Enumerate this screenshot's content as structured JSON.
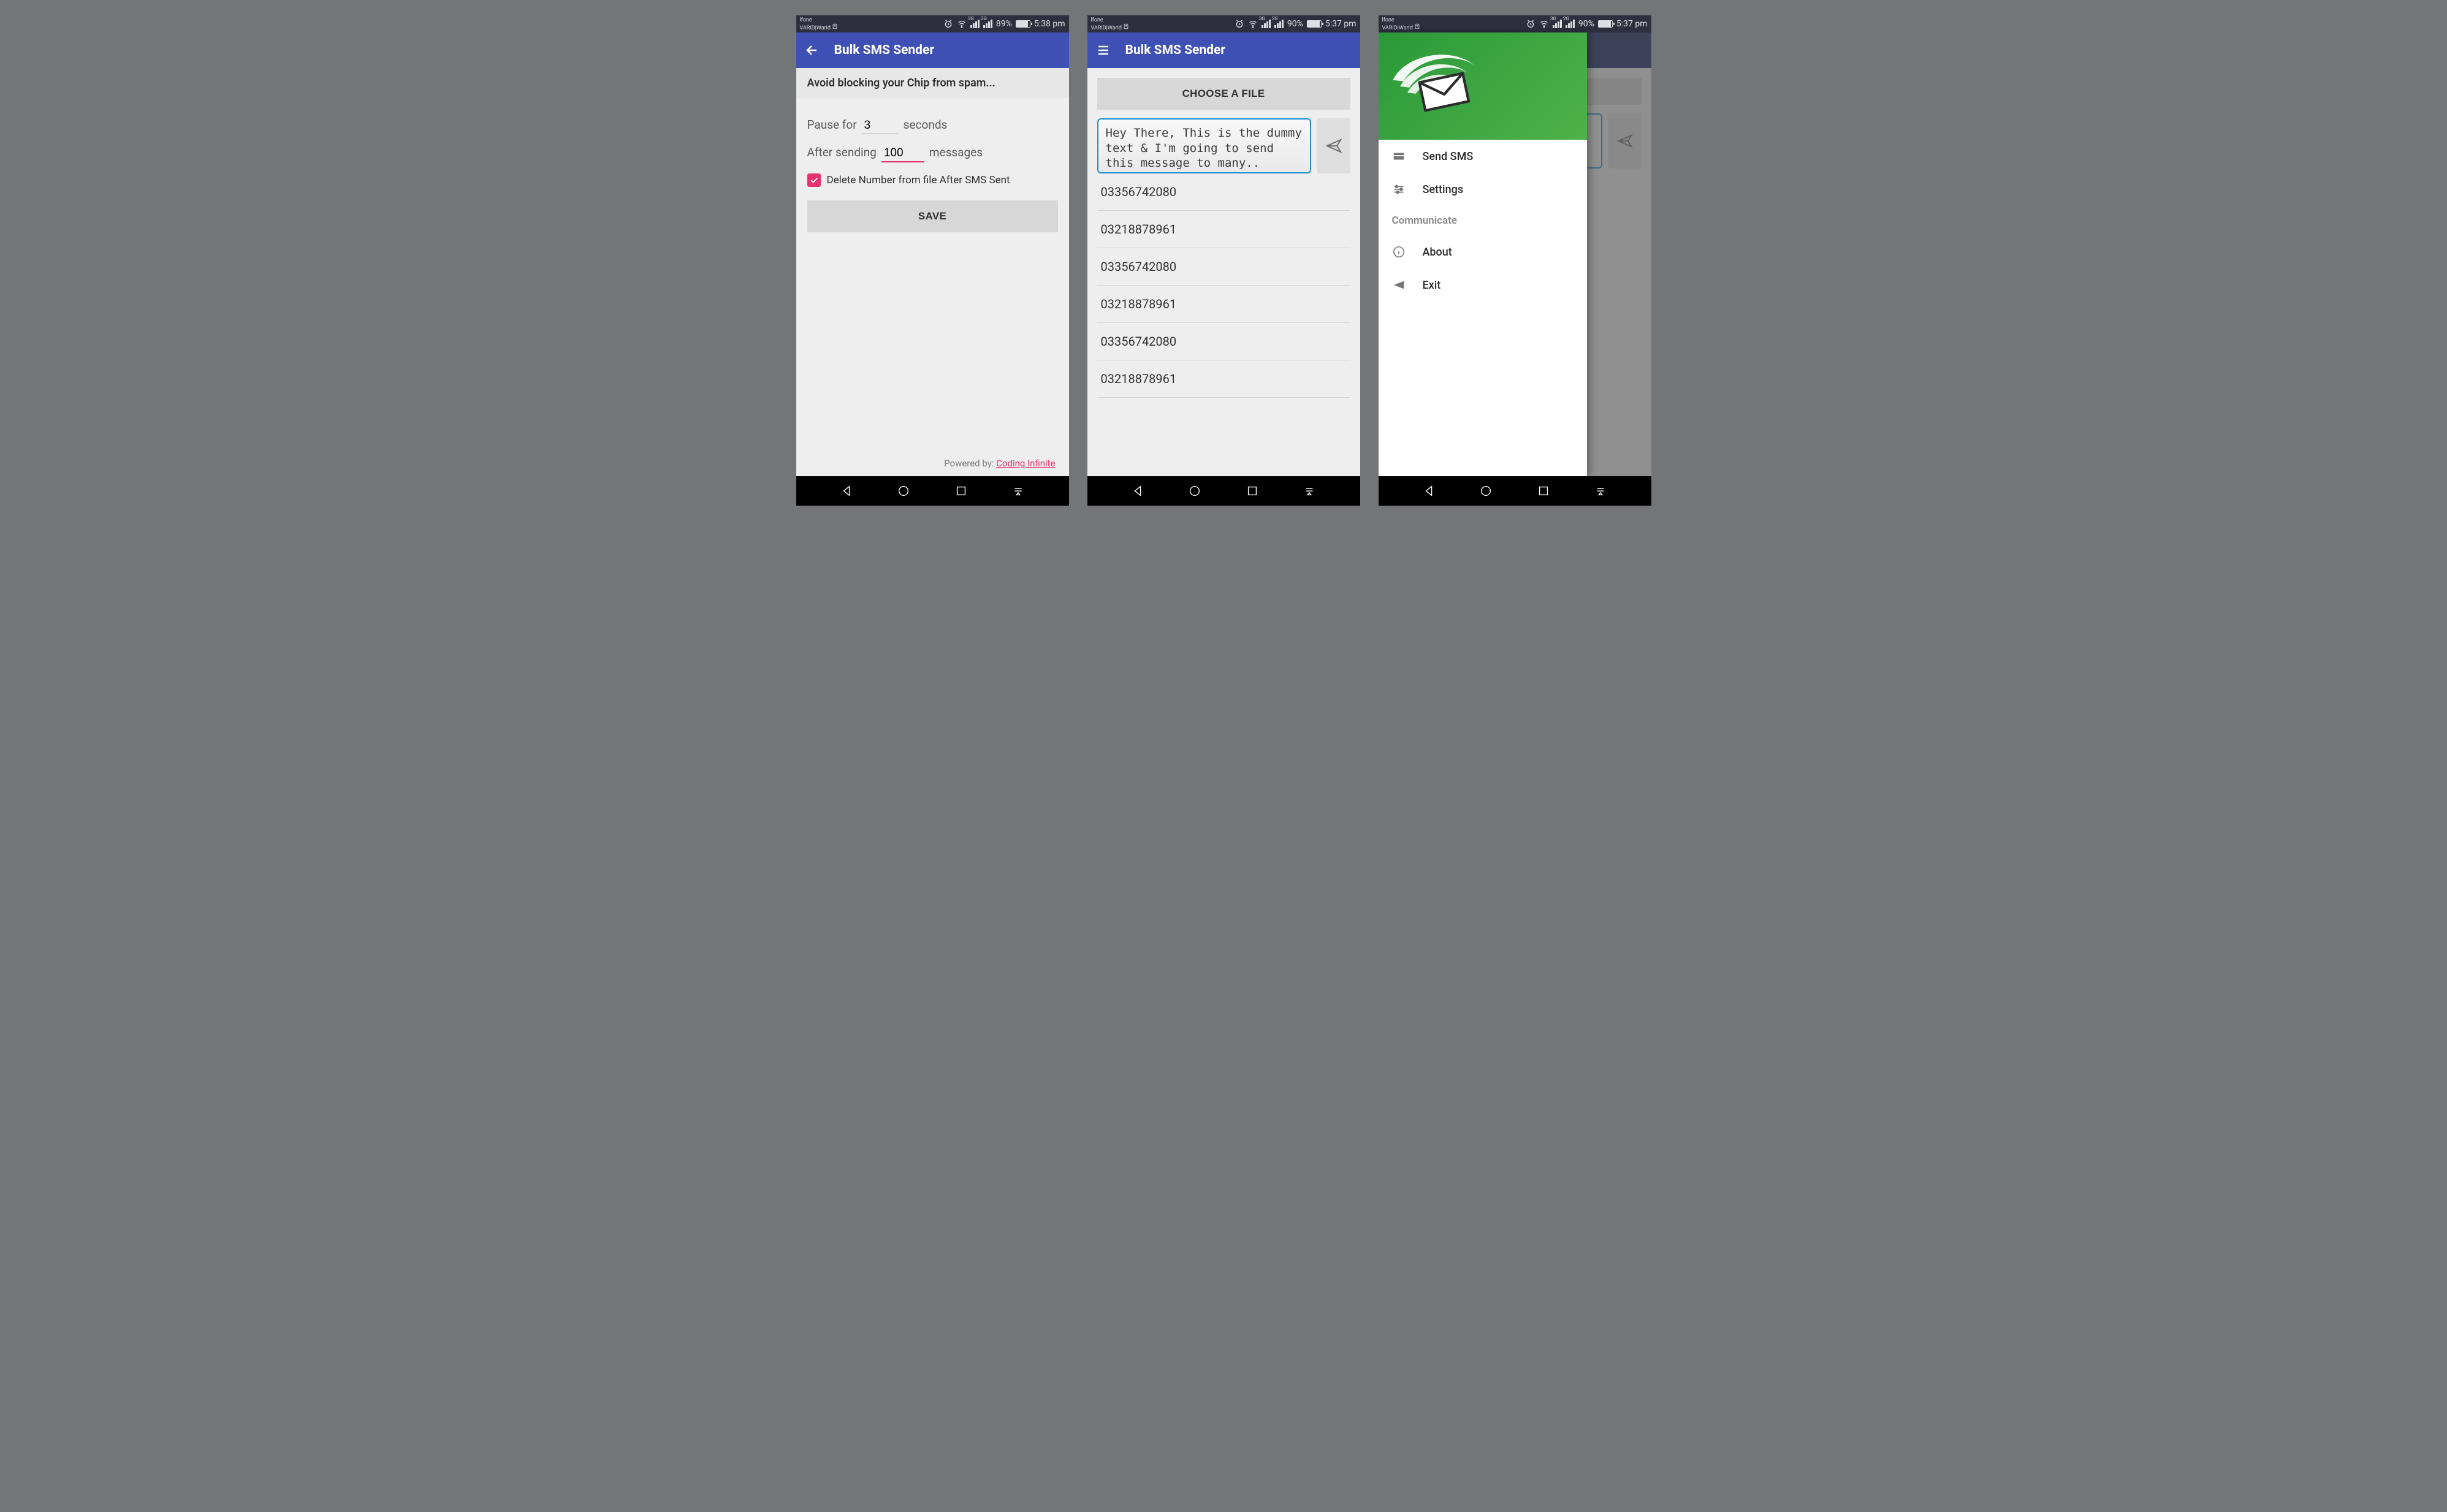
{
  "colors": {
    "appbar": "#3e50b4",
    "accent": "#e6336f",
    "drawer_green": "#3fa043"
  },
  "status_bars": [
    {
      "carrier_top": "lfone",
      "carrier_bottom": "VARID|Warid",
      "battery_pct": "89%",
      "time": "5:38 pm",
      "sig1": "3G",
      "sig2": "2G"
    },
    {
      "carrier_top": "lfone",
      "carrier_bottom": "VARID|Warid",
      "battery_pct": "90%",
      "time": "5:37 pm",
      "sig1": "3G",
      "sig2": "2G"
    },
    {
      "carrier_top": "lfone",
      "carrier_bottom": "VARID|Warid",
      "battery_pct": "90%",
      "time": "5:37 pm",
      "sig1": "3G",
      "sig2": "2G"
    }
  ],
  "app_title": "Bulk SMS Sender",
  "screen1": {
    "heading": "Avoid blocking your Chip from spam...",
    "pause_prefix": "Pause for",
    "pause_value": "3",
    "pause_suffix": "seconds",
    "after_prefix": "After sending",
    "after_value": "100",
    "after_suffix": "messages",
    "checkbox_label": "Delete Number from file After SMS Sent",
    "save": "SAVE",
    "footer_prefix": "Powered by: ",
    "footer_link": "Coding Infinite"
  },
  "screen2": {
    "choose": "CHOOSE A FILE",
    "message": "Hey There, This is the dummy text & I'm going to send this message to many..",
    "numbers": [
      "03356742080",
      "03218878961",
      "03356742080",
      "03218878961",
      "03356742080",
      "03218878961"
    ]
  },
  "screen3": {
    "items_top": [
      {
        "icon": "sms",
        "label": "Send SMS"
      },
      {
        "icon": "settings",
        "label": "Settings"
      }
    ],
    "section": "Communicate",
    "items_bottom": [
      {
        "icon": "info",
        "label": "About"
      },
      {
        "icon": "exit",
        "label": "Exit"
      }
    ]
  }
}
